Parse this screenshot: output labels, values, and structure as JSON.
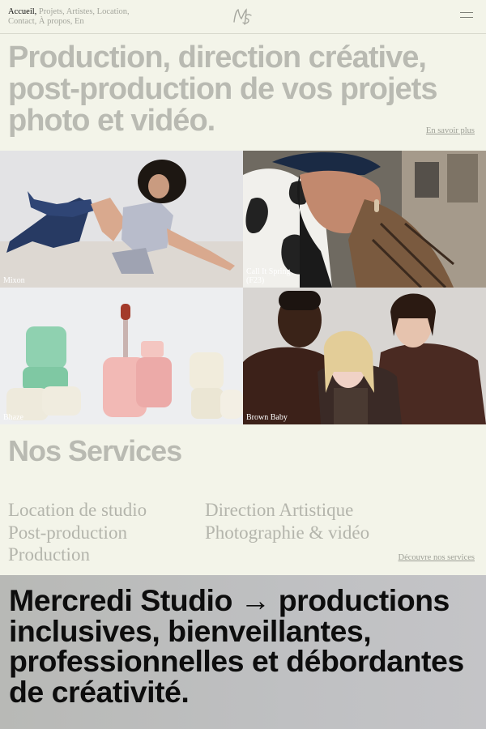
{
  "nav": {
    "items": [
      {
        "label": "Accueil,",
        "active": true
      },
      {
        "label": "Projets,"
      },
      {
        "label": "Artistes,"
      },
      {
        "label": "Location,"
      },
      {
        "label": "Contact,"
      },
      {
        "label": "À propos,"
      },
      {
        "label": "En"
      }
    ]
  },
  "hero": {
    "title": "Production, direction créative, post-production de vos projets photo et vidéo.",
    "link": "En savoir plus"
  },
  "projects": [
    {
      "caption": "Mixon"
    },
    {
      "caption": "Call It Spring (F23)"
    },
    {
      "caption": "Bhaze"
    },
    {
      "caption": "Brown Baby"
    }
  ],
  "services": {
    "title": "Nos Services",
    "col1": [
      "Location de studio",
      "Post-production",
      "Production"
    ],
    "col2": [
      "Direction Artistique",
      "Photographie & vidéo"
    ],
    "link": "Découvre nos services"
  },
  "banner": {
    "text": "Mercredi Studio → productions inclusives, bienveillantes, professionnelles et débordantes de créativité."
  },
  "colors": {
    "background": "#f3f4e9",
    "muted_text": "#b9bab2",
    "banner_bg": "#bebfc0"
  }
}
